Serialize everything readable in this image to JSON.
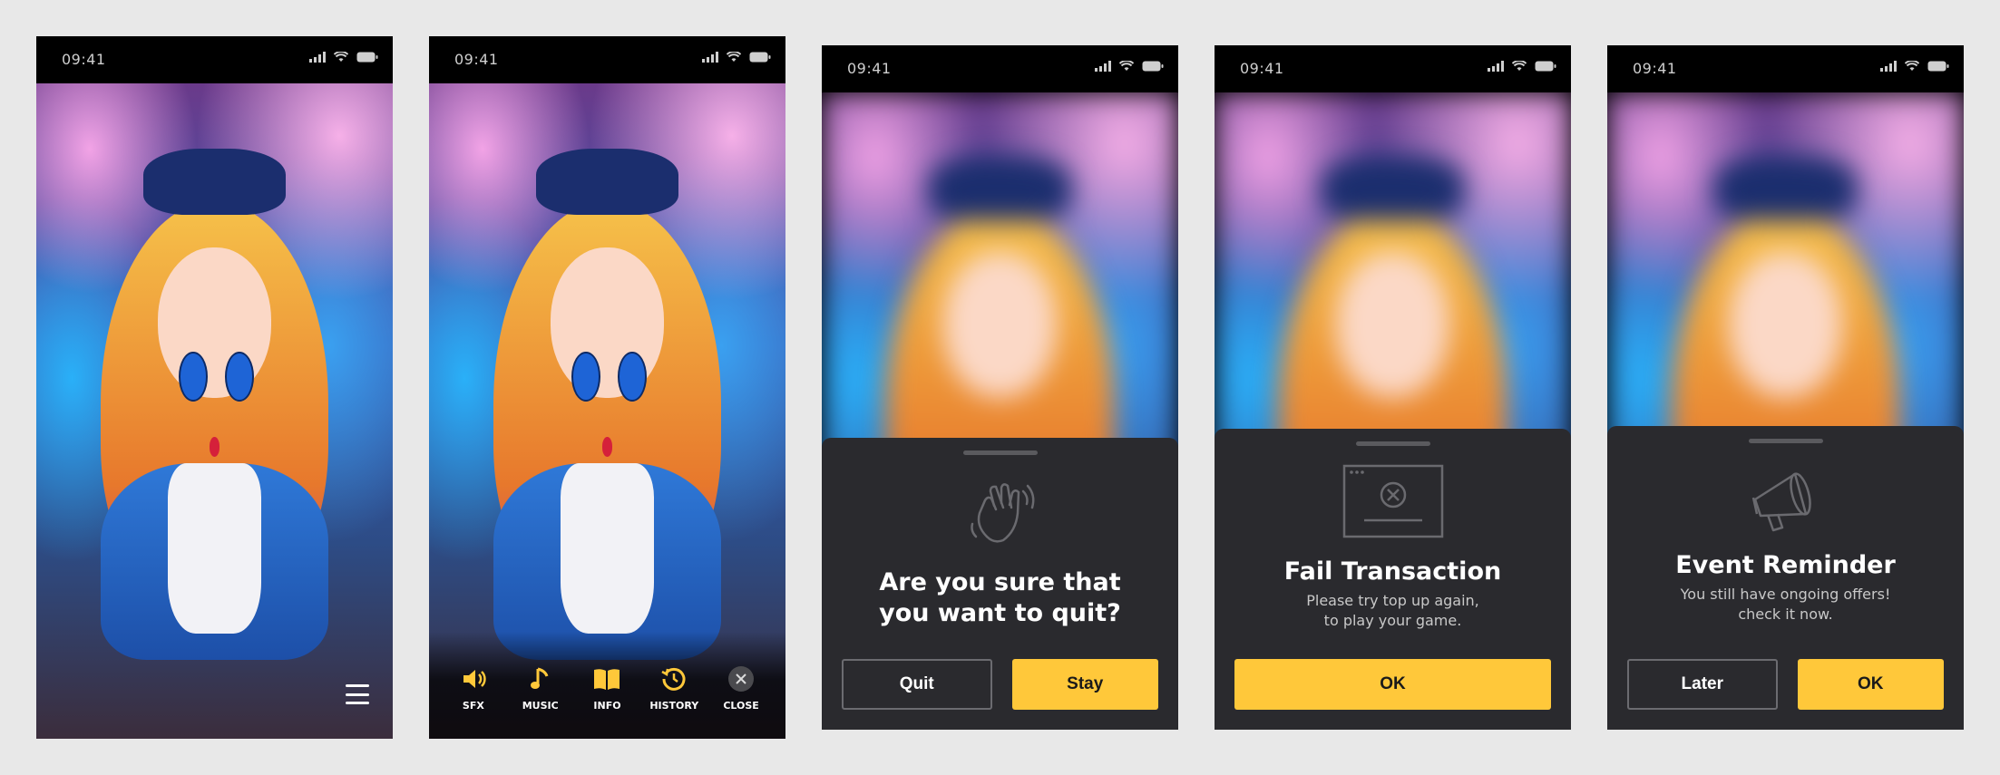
{
  "status": {
    "time": "09:41"
  },
  "menu": {
    "sfx": "SFX",
    "music": "MUSIC",
    "info": "INFO",
    "history": "HISTORY",
    "close": "CLOSE"
  },
  "dialogs": {
    "quit": {
      "title_line1": "Are you sure that",
      "title_line2": "you want to quit?",
      "secondary": "Quit",
      "primary": "Stay",
      "icon": "waving-hand-icon"
    },
    "fail": {
      "title": "Fail Transaction",
      "sub_line1": "Please try top up again,",
      "sub_line2": "to play your game.",
      "primary": "OK",
      "icon": "failed-window-icon"
    },
    "event": {
      "title": "Event Reminder",
      "sub_line1": "You still have ongoing offers!",
      "sub_line2": "check it now.",
      "secondary": "Later",
      "primary": "OK",
      "icon": "megaphone-icon"
    }
  },
  "colors": {
    "accent": "#ffc83a",
    "sheet": "#2a2a2e",
    "background": "#e8e8e8"
  }
}
